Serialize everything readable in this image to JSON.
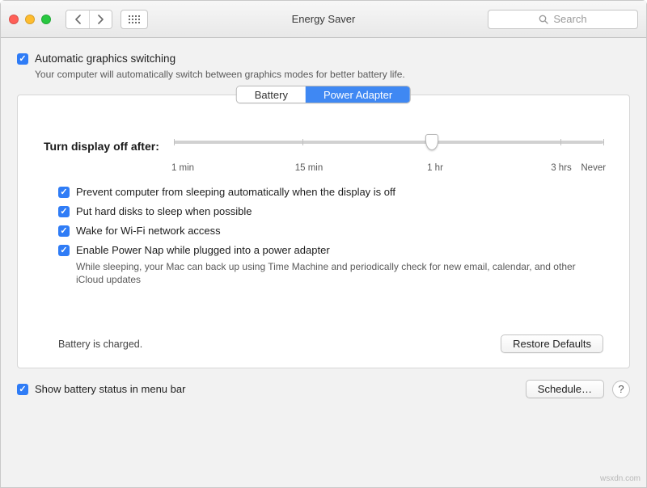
{
  "window_title": "Energy Saver",
  "search_placeholder": "Search",
  "auto_switch": {
    "label": "Automatic graphics switching",
    "description": "Your computer will automatically switch between graphics modes for better battery life."
  },
  "tabs": {
    "battery": "Battery",
    "power_adapter": "Power Adapter",
    "active": "power_adapter"
  },
  "slider": {
    "label": "Turn display off after:",
    "ticks": {
      "min1": "1 min",
      "min15": "15 min",
      "hr1": "1 hr",
      "hr3": "3 hrs",
      "never": "Never"
    }
  },
  "opts": {
    "prevent_sleep": "Prevent computer from sleeping automatically when the display is off",
    "hdd_sleep": "Put hard disks to sleep when possible",
    "wake_wifi": "Wake for Wi-Fi network access",
    "power_nap": "Enable Power Nap while plugged into a power adapter",
    "power_nap_desc": "While sleeping, your Mac can back up using Time Machine and periodically check for new email, calendar, and other iCloud updates"
  },
  "battery_status": "Battery is charged.",
  "buttons": {
    "restore_defaults": "Restore Defaults",
    "schedule": "Schedule…"
  },
  "show_battery_menubar": "Show battery status in menu bar",
  "help_glyph": "?",
  "watermark": "wsxdn.com"
}
